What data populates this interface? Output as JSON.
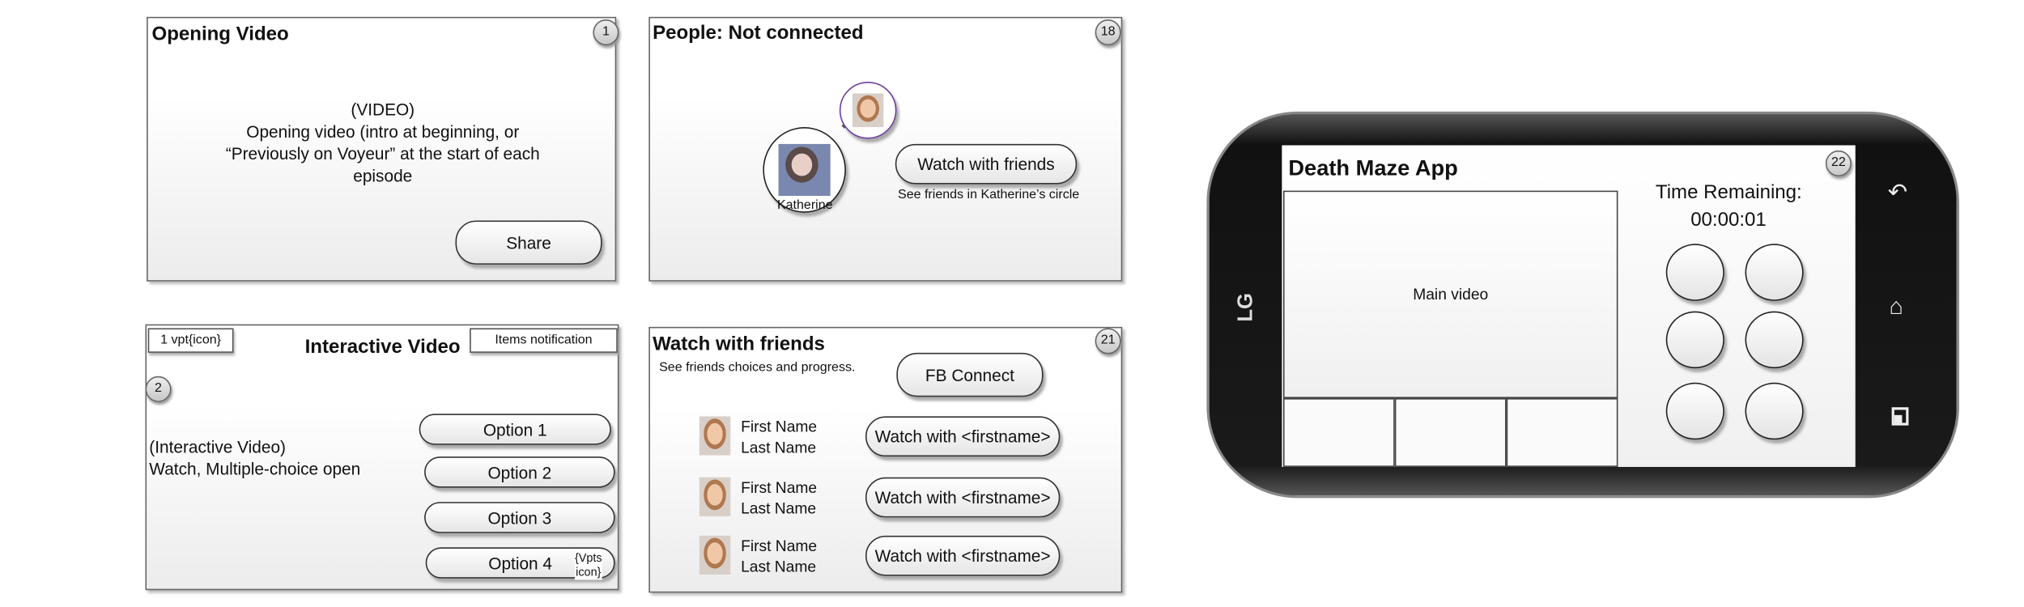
{
  "panels": {
    "opening": {
      "title": "Opening Video",
      "badge": "1",
      "lines": [
        "(VIDEO)",
        "Opening video (intro at beginning, or",
        "“Previously on Voyeur” at the start of each",
        "episode"
      ],
      "share": "Share"
    },
    "people": {
      "title": "People: Not connected",
      "badge": "18",
      "person": "Katherine",
      "watch": "Watch with friends",
      "caption": "See friends in Katherine’s circle"
    },
    "interactive": {
      "title": "Interactive Video",
      "badge": "2",
      "vpt": "1 vpt{icon}",
      "notification": "Items notification",
      "lines": [
        "(Interactive Video)",
        "Watch, Multiple-choice open"
      ],
      "options": [
        "Option 1",
        "Option 2",
        "Option 3",
        "Option 4"
      ],
      "vpts_icon": [
        "{Vpts",
        "icon}"
      ]
    },
    "friends": {
      "title": "Watch with friends",
      "badge": "21",
      "subtitle": "See friends choices and progress.",
      "fb": "FB Connect",
      "rows": [
        {
          "first": "First Name",
          "last": "Last Name",
          "button": "Watch with <firstname>"
        },
        {
          "first": "First Name",
          "last": "Last Name",
          "button": "Watch with <firstname>"
        },
        {
          "first": "First Name",
          "last": "Last Name",
          "button": "Watch with <firstname>"
        }
      ]
    }
  },
  "phone": {
    "brand": "LG",
    "title": "Death Maze App",
    "badge": "22",
    "main_video": "Main video",
    "time_label": "Time Remaining:",
    "time_value": "00:00:01"
  }
}
